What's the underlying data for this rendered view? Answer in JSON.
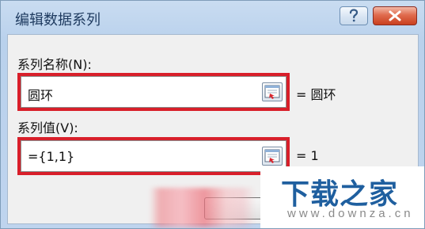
{
  "dialog": {
    "title": "编辑数据系列",
    "help_label": "?",
    "close_label": "X"
  },
  "series_name": {
    "label": "系列名称(N):",
    "value": "圆环",
    "preview": "= 圆环"
  },
  "series_values": {
    "label": "系列值(V):",
    "value": "={1,1}",
    "preview": "= 1"
  },
  "watermark": {
    "title": "下载之家",
    "url": "www.downza.cn"
  },
  "colors": {
    "highlight": "#d81f2a",
    "close_button": "#d24d2e",
    "title_bar": "#c4d8ef",
    "watermark_text": "#1f5f9f"
  },
  "icons": {
    "help": "question-mark-icon",
    "close": "close-icon",
    "collapse": "collapse-dialog-icon"
  }
}
